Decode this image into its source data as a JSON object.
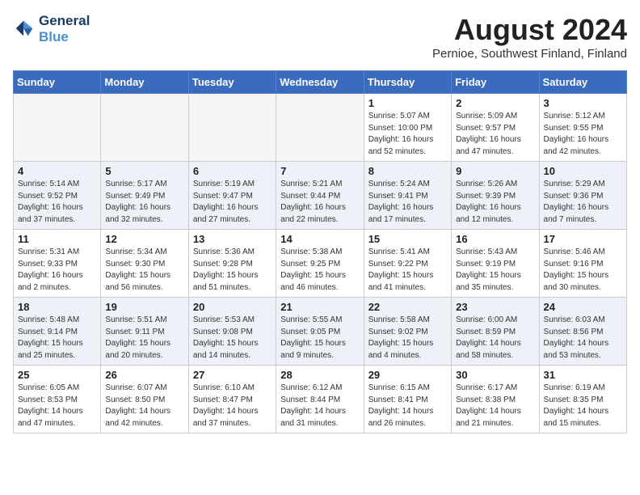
{
  "header": {
    "logo_line1": "General",
    "logo_line2": "Blue",
    "month_title": "August 2024",
    "location": "Pernioe, Southwest Finland, Finland"
  },
  "days_of_week": [
    "Sunday",
    "Monday",
    "Tuesday",
    "Wednesday",
    "Thursday",
    "Friday",
    "Saturday"
  ],
  "weeks": [
    {
      "row_class": "row-even",
      "days": [
        {
          "date": "",
          "info": "",
          "empty": true
        },
        {
          "date": "",
          "info": "",
          "empty": true
        },
        {
          "date": "",
          "info": "",
          "empty": true
        },
        {
          "date": "",
          "info": "",
          "empty": true
        },
        {
          "date": "1",
          "info": "Sunrise: 5:07 AM\nSunset: 10:00 PM\nDaylight: 16 hours\nand 52 minutes."
        },
        {
          "date": "2",
          "info": "Sunrise: 5:09 AM\nSunset: 9:57 PM\nDaylight: 16 hours\nand 47 minutes."
        },
        {
          "date": "3",
          "info": "Sunrise: 5:12 AM\nSunset: 9:55 PM\nDaylight: 16 hours\nand 42 minutes."
        }
      ]
    },
    {
      "row_class": "row-odd",
      "days": [
        {
          "date": "4",
          "info": "Sunrise: 5:14 AM\nSunset: 9:52 PM\nDaylight: 16 hours\nand 37 minutes."
        },
        {
          "date": "5",
          "info": "Sunrise: 5:17 AM\nSunset: 9:49 PM\nDaylight: 16 hours\nand 32 minutes."
        },
        {
          "date": "6",
          "info": "Sunrise: 5:19 AM\nSunset: 9:47 PM\nDaylight: 16 hours\nand 27 minutes."
        },
        {
          "date": "7",
          "info": "Sunrise: 5:21 AM\nSunset: 9:44 PM\nDaylight: 16 hours\nand 22 minutes."
        },
        {
          "date": "8",
          "info": "Sunrise: 5:24 AM\nSunset: 9:41 PM\nDaylight: 16 hours\nand 17 minutes."
        },
        {
          "date": "9",
          "info": "Sunrise: 5:26 AM\nSunset: 9:39 PM\nDaylight: 16 hours\nand 12 minutes."
        },
        {
          "date": "10",
          "info": "Sunrise: 5:29 AM\nSunset: 9:36 PM\nDaylight: 16 hours\nand 7 minutes."
        }
      ]
    },
    {
      "row_class": "row-even",
      "days": [
        {
          "date": "11",
          "info": "Sunrise: 5:31 AM\nSunset: 9:33 PM\nDaylight: 16 hours\nand 2 minutes."
        },
        {
          "date": "12",
          "info": "Sunrise: 5:34 AM\nSunset: 9:30 PM\nDaylight: 15 hours\nand 56 minutes."
        },
        {
          "date": "13",
          "info": "Sunrise: 5:36 AM\nSunset: 9:28 PM\nDaylight: 15 hours\nand 51 minutes."
        },
        {
          "date": "14",
          "info": "Sunrise: 5:38 AM\nSunset: 9:25 PM\nDaylight: 15 hours\nand 46 minutes."
        },
        {
          "date": "15",
          "info": "Sunrise: 5:41 AM\nSunset: 9:22 PM\nDaylight: 15 hours\nand 41 minutes."
        },
        {
          "date": "16",
          "info": "Sunrise: 5:43 AM\nSunset: 9:19 PM\nDaylight: 15 hours\nand 35 minutes."
        },
        {
          "date": "17",
          "info": "Sunrise: 5:46 AM\nSunset: 9:16 PM\nDaylight: 15 hours\nand 30 minutes."
        }
      ]
    },
    {
      "row_class": "row-odd",
      "days": [
        {
          "date": "18",
          "info": "Sunrise: 5:48 AM\nSunset: 9:14 PM\nDaylight: 15 hours\nand 25 minutes."
        },
        {
          "date": "19",
          "info": "Sunrise: 5:51 AM\nSunset: 9:11 PM\nDaylight: 15 hours\nand 20 minutes."
        },
        {
          "date": "20",
          "info": "Sunrise: 5:53 AM\nSunset: 9:08 PM\nDaylight: 15 hours\nand 14 minutes."
        },
        {
          "date": "21",
          "info": "Sunrise: 5:55 AM\nSunset: 9:05 PM\nDaylight: 15 hours\nand 9 minutes."
        },
        {
          "date": "22",
          "info": "Sunrise: 5:58 AM\nSunset: 9:02 PM\nDaylight: 15 hours\nand 4 minutes."
        },
        {
          "date": "23",
          "info": "Sunrise: 6:00 AM\nSunset: 8:59 PM\nDaylight: 14 hours\nand 58 minutes."
        },
        {
          "date": "24",
          "info": "Sunrise: 6:03 AM\nSunset: 8:56 PM\nDaylight: 14 hours\nand 53 minutes."
        }
      ]
    },
    {
      "row_class": "row-even",
      "days": [
        {
          "date": "25",
          "info": "Sunrise: 6:05 AM\nSunset: 8:53 PM\nDaylight: 14 hours\nand 47 minutes."
        },
        {
          "date": "26",
          "info": "Sunrise: 6:07 AM\nSunset: 8:50 PM\nDaylight: 14 hours\nand 42 minutes."
        },
        {
          "date": "27",
          "info": "Sunrise: 6:10 AM\nSunset: 8:47 PM\nDaylight: 14 hours\nand 37 minutes."
        },
        {
          "date": "28",
          "info": "Sunrise: 6:12 AM\nSunset: 8:44 PM\nDaylight: 14 hours\nand 31 minutes."
        },
        {
          "date": "29",
          "info": "Sunrise: 6:15 AM\nSunset: 8:41 PM\nDaylight: 14 hours\nand 26 minutes."
        },
        {
          "date": "30",
          "info": "Sunrise: 6:17 AM\nSunset: 8:38 PM\nDaylight: 14 hours\nand 21 minutes."
        },
        {
          "date": "31",
          "info": "Sunrise: 6:19 AM\nSunset: 8:35 PM\nDaylight: 14 hours\nand 15 minutes."
        }
      ]
    }
  ]
}
